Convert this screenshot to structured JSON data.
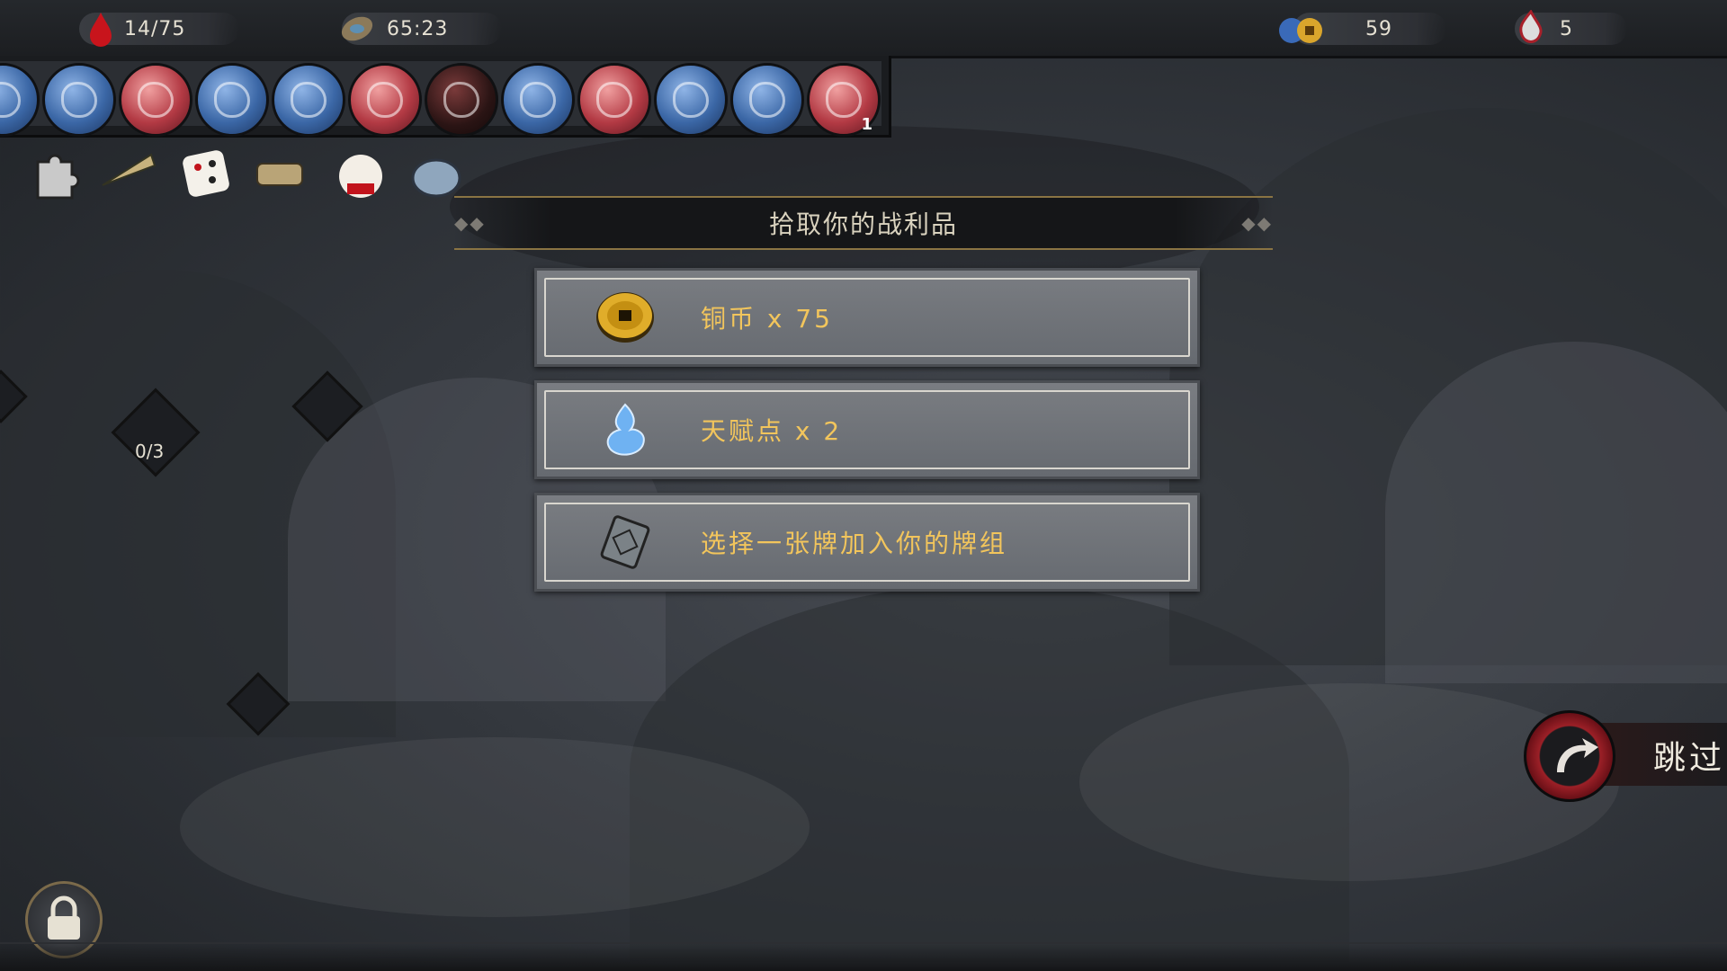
{
  "hud": {
    "hp": "14/75",
    "timer": "65:23",
    "coins": "59",
    "talent_points": "5"
  },
  "abilities": [
    {
      "color": "blue",
      "count": ""
    },
    {
      "color": "blue",
      "count": ""
    },
    {
      "color": "red",
      "count": ""
    },
    {
      "color": "blue",
      "count": ""
    },
    {
      "color": "blue",
      "count": ""
    },
    {
      "color": "red",
      "count": ""
    },
    {
      "color": "dark",
      "count": ""
    },
    {
      "color": "blue",
      "count": ""
    },
    {
      "color": "red",
      "count": ""
    },
    {
      "color": "blue",
      "count": ""
    },
    {
      "color": "blue",
      "count": ""
    },
    {
      "color": "red",
      "count": "1"
    }
  ],
  "relics": [
    "puzzle-piece-icon",
    "straw-hat-icon",
    "dice-icon",
    "scroll-icon",
    "lucky-cat-icon",
    "teapot-icon"
  ],
  "loot": {
    "title": "拾取你的战利品",
    "options": [
      {
        "icon": "copper-coin-icon",
        "label": "铜币 x 75"
      },
      {
        "icon": "talent-spirit-icon",
        "label": "天赋点 x 2"
      },
      {
        "icon": "card-icon",
        "label": "选择一张牌加入你的牌组"
      }
    ]
  },
  "map": {
    "node_progress": "0/3"
  },
  "skip": {
    "label": "跳过"
  },
  "colors": {
    "gold_text": "#f2c55c",
    "accent_red": "#9c2027"
  }
}
